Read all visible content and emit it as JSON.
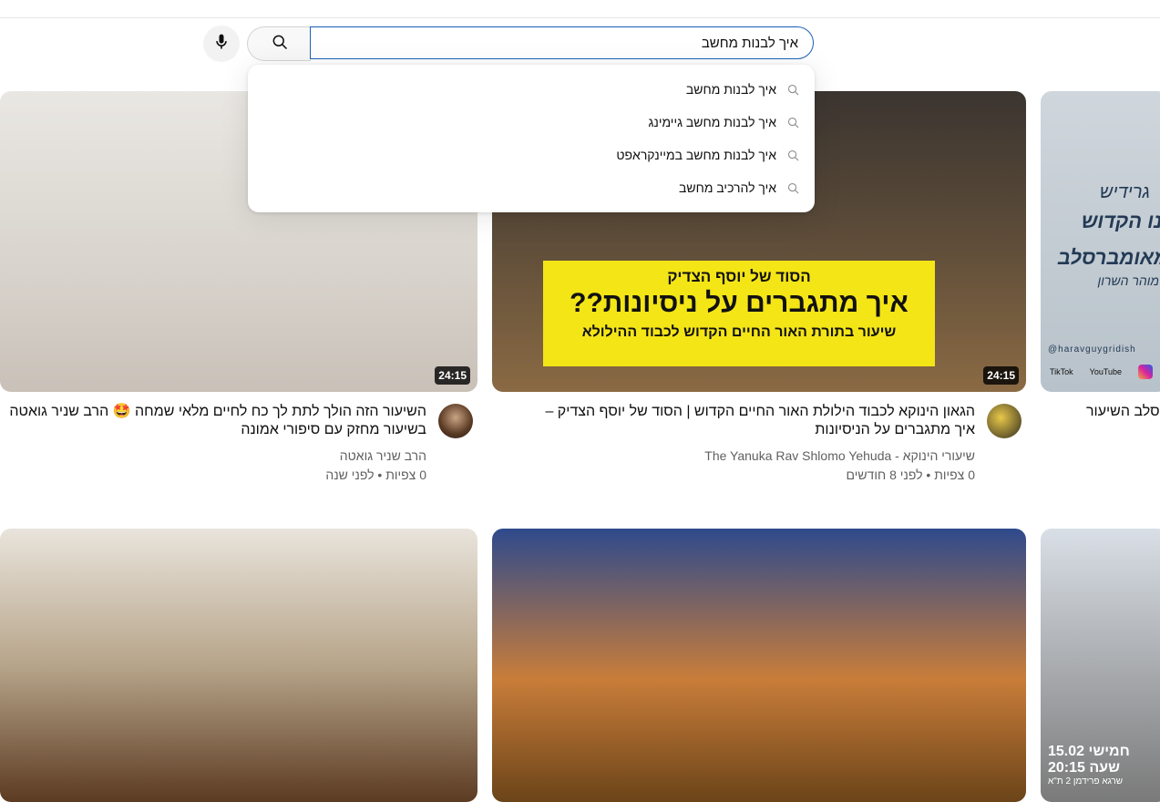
{
  "search": {
    "value": "איך לבנות מחשב",
    "suggestions": [
      "איך לבנות מחשב",
      "איך לבנות מחשב גיימינג",
      "איך לבנות מחשב במיינקראפט",
      "איך להרכיב מחשב"
    ]
  },
  "icons": {
    "mic": "mic-icon",
    "search": "search-icon"
  },
  "videos": [
    {
      "title": "השיעור הזה הולך לתת לך כח לחיים מלאי שמחה 🤩 הרב שניר גואטה בשיעור מחזק עם סיפורי אמונה",
      "channel": "הרב שניר גואטה",
      "stats": "0 צפיות • לפני שנה",
      "duration": "24:15"
    },
    {
      "title": "הגאון הינוקא לכבוד הילולת האור החיים הקדוש | הסוד של יוסף הצדיק – איך מתגברים על הניסיונות",
      "channel": "שיעורי הינוקא - The Yanuka Rav Shlomo Yehuda",
      "stats": "0 צפיות • לפני 8 חודשים",
      "duration": "24:15",
      "thumb_text": {
        "line1": "הסוד של יוסף הצדיק",
        "line2": "איך מתגברים על ניסיונות??",
        "line3": "שיעור בתורת האור החיים הקדוש לכבוד ההילולא"
      }
    },
    {
      "title": "סלב השיעור",
      "thumb_text": {
        "line1": "גרידיש",
        "line2": "ינו הקדוש",
        "line3": "מאומברסלב",
        "line4": "מוהר השרון",
        "handle": "@haravguygridish",
        "social1": "TikTok",
        "social2": "YouTube"
      }
    },
    {},
    {},
    {
      "thumb_text": {
        "line1": "חמישי 15.02",
        "line2": "שעה 20:15",
        "line3": "שרגא פרידמן 2 ת\"א"
      }
    }
  ],
  "colors": {
    "accent": "#1c62b9",
    "banner": "#f4e517"
  }
}
